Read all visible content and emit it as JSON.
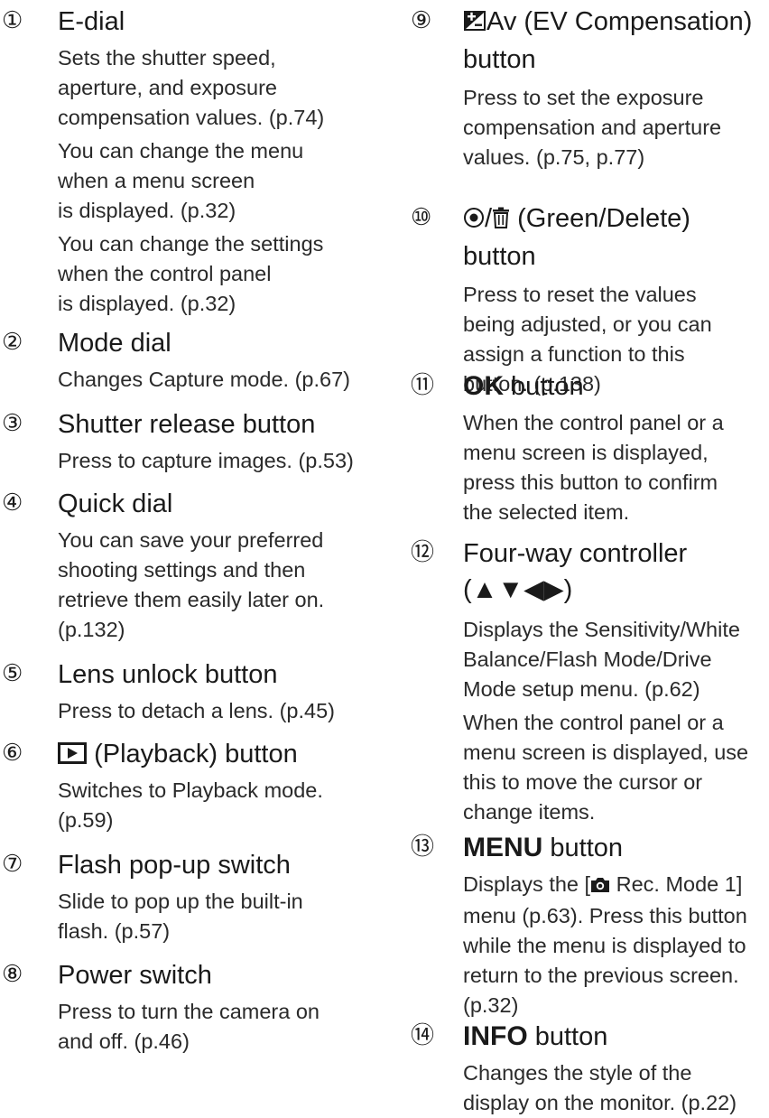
{
  "left_items": [
    {
      "num": "①",
      "title": "E-dial",
      "paras": [
        [
          "Sets the shutter speed,",
          "aperture, and exposure",
          "compensation values. (p.74)"
        ],
        [
          "You can change the menu",
          "when a menu screen",
          "is displayed. (p.32)"
        ],
        [
          "You can change the settings",
          "when the control panel",
          "is displayed. (p.32)"
        ]
      ]
    },
    {
      "num": "②",
      "title": "Mode dial",
      "paras": [
        [
          "Changes Capture mode. (p.67)"
        ]
      ]
    },
    {
      "num": "③",
      "title": "Shutter release button",
      "paras": [
        [
          "Press to capture images. (p.53)"
        ]
      ]
    },
    {
      "num": "④",
      "title": "Quick dial",
      "paras": [
        [
          "You can save your preferred",
          "shooting settings and then",
          "retrieve them easily later on.",
          "(p.132)"
        ]
      ]
    },
    {
      "num": "⑤",
      "title": "Lens unlock button",
      "paras": [
        [
          "Press to detach a lens. (p.45)"
        ]
      ]
    },
    {
      "num": "⑥",
      "title": "(Playback) button",
      "paras": [
        [
          "Switches to Playback mode.",
          "(p.59)"
        ]
      ]
    },
    {
      "num": "⑦",
      "title": "Flash pop-up switch",
      "paras": [
        [
          "Slide to pop up the built-in",
          "flash. (p.57)"
        ]
      ]
    },
    {
      "num": "⑧",
      "title": "Power switch",
      "paras": [
        [
          "Press to turn the camera on",
          "and off. (p.46)"
        ]
      ]
    }
  ],
  "right_items": [
    {
      "num": "⑨",
      "title_a": "Av (EV Compensation)",
      "title_b": "button",
      "paras": [
        [
          "Press to set the exposure",
          "compensation and aperture",
          "values. (p.75, p.77)"
        ]
      ]
    },
    {
      "num": "⑩",
      "title_a": "/",
      "title_a2": "(Green/Delete)",
      "title_b": "button",
      "paras": [
        [
          "Press to reset the values",
          "being adjusted, or you can",
          "assign a function to this",
          "button. (p.138)"
        ]
      ]
    },
    {
      "num": "⑪",
      "title_strong": "OK",
      "title_rest": " button",
      "paras": [
        [
          "When the control panel or a",
          "menu screen is displayed,",
          "press this button to confirm",
          "the selected item."
        ]
      ]
    },
    {
      "num": "⑫",
      "title_a": "Four-way controller",
      "title_b": "(▲▼◀▶)",
      "paras": [
        [
          "Displays the Sensitivity/White",
          "Balance/Flash Mode/Drive",
          "Mode setup menu. (p.62)"
        ],
        [
          "When the control panel or a",
          "menu screen is displayed, use",
          "this to move the cursor or",
          "change items."
        ]
      ]
    },
    {
      "num": "⑬",
      "title_strong": "MENU",
      "title_rest": " button",
      "paras_rich": [
        {
          "pre": "Displays the [",
          "post": " Rec. Mode 1]"
        },
        {
          "lines": [
            "menu (p.63). Press this button",
            "while the menu is displayed to",
            "return to the previous screen.",
            "(p.32)"
          ]
        }
      ]
    },
    {
      "num": "⑭",
      "title_strong": "INFO",
      "title_rest": " button",
      "paras": [
        [
          "Changes the style of the",
          "display on the monitor. (p.22)"
        ]
      ]
    }
  ],
  "icons": {
    "playback": "playback-icon",
    "ev": "ev-compensation-icon",
    "green": "green-button-icon",
    "delete": "trash-icon",
    "camera": "camera-icon"
  }
}
